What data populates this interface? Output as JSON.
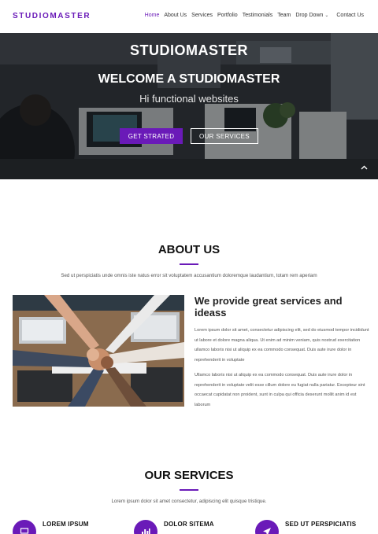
{
  "brand": "STUDIOMASTER",
  "nav": {
    "items": [
      "Home",
      "About Us",
      "Services",
      "Portfolio",
      "Testimonials",
      "Team",
      "Drop Down",
      "Contact Us"
    ],
    "active": "Home"
  },
  "hero": {
    "title": "STUDIOMASTER",
    "heading": "WELCOME A STUDIOMASTER",
    "subtitle": "Hi functional websites",
    "primary_button": "GET STRATED",
    "secondary_button": "OUR SERVICES"
  },
  "about": {
    "title": "ABOUT US",
    "intro": "Sed ut perspiciatis unde omnis iste natus error sit voluptatem accusantium doloremque laudantium, totam rem aperiam",
    "heading": "We provide great services and ideass",
    "paragraph1": "Lorem ipsum dolor sit amet, consectetur adipiscing elit, sed do eiusmod tempor incididunt ut labore et dolore magna aliqua. Ut enim ad minim veniam, quis nostrud exercitation ullamco laboris nisi ut aliquip ex ea commodo consequat. Duis aute irure dolor in reprehenderit in voluptate",
    "paragraph2": "Ullamco laboris nisi ut aliquip ex ea commodo consequat. Duis aute irure dolor in reprehenderit in voluptate velit esse cillum dolore eu fugiat nulla pariatur. Excepteur sint occaecat cupidatat non proident, sunt in culpa qui officia deserunt mollit anim id est laborum"
  },
  "services": {
    "title": "OUR SERVICES",
    "intro": "Lorem ipsum dolor sit amet consectetur, adipiscing elit quisque tristique.",
    "items": [
      {
        "title": "LOREM IPSUM",
        "icon": "laptop-icon"
      },
      {
        "title": "DOLOR SITEMA",
        "icon": "bar-chart-icon"
      },
      {
        "title": "SED UT PERSPICIATIS",
        "icon": "paper-plane-icon"
      }
    ]
  },
  "colors": {
    "accent": "#6a1ab8",
    "text": "#222222",
    "muted": "#555555"
  }
}
